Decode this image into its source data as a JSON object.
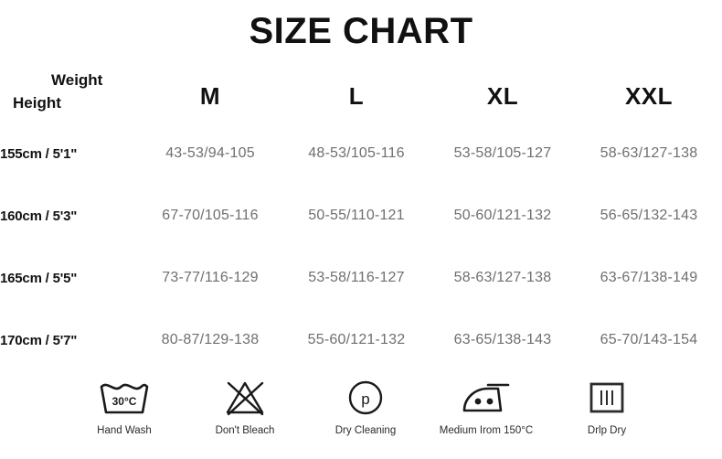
{
  "title": "SIZE CHART",
  "table": {
    "corner": {
      "weight_label": "Weight",
      "height_label": "Height"
    },
    "size_headers": [
      "M",
      "L",
      "XL",
      "XXL"
    ],
    "rows": [
      {
        "height": "155cm / 5'1\"",
        "values": [
          "43-53/94-105",
          "48-53/105-116",
          "53-58/105-127",
          "58-63/127-138"
        ]
      },
      {
        "height": "160cm / 5'3\"",
        "values": [
          "67-70/105-116",
          "50-55/110-121",
          "50-60/121-132",
          "56-65/132-143"
        ]
      },
      {
        "height": "165cm / 5'5\"",
        "values": [
          "73-77/116-129",
          "53-58/116-127",
          "58-63/127-138",
          "63-67/138-149"
        ]
      },
      {
        "height": "170cm / 5'7\"",
        "values": [
          "80-87/129-138",
          "55-60/121-132",
          "63-65/138-143",
          "65-70/143-154"
        ]
      }
    ]
  },
  "care_instructions": [
    {
      "icon": "wash-tub-icon",
      "temp": "30°C",
      "label": "Hand Wash"
    },
    {
      "icon": "no-bleach-triangle-icon",
      "label": "Don't Bleach"
    },
    {
      "icon": "dry-clean-circle-p-icon",
      "letter": "p",
      "label": "Dry Cleaning"
    },
    {
      "icon": "iron-two-dots-icon",
      "label": "Medium Irom 150°C"
    },
    {
      "icon": "drip-dry-square-icon",
      "label": "Drlp Dry"
    }
  ],
  "colors": {
    "text": "#111111",
    "measure_text": "#6f6f6f",
    "background": "#ffffff"
  }
}
